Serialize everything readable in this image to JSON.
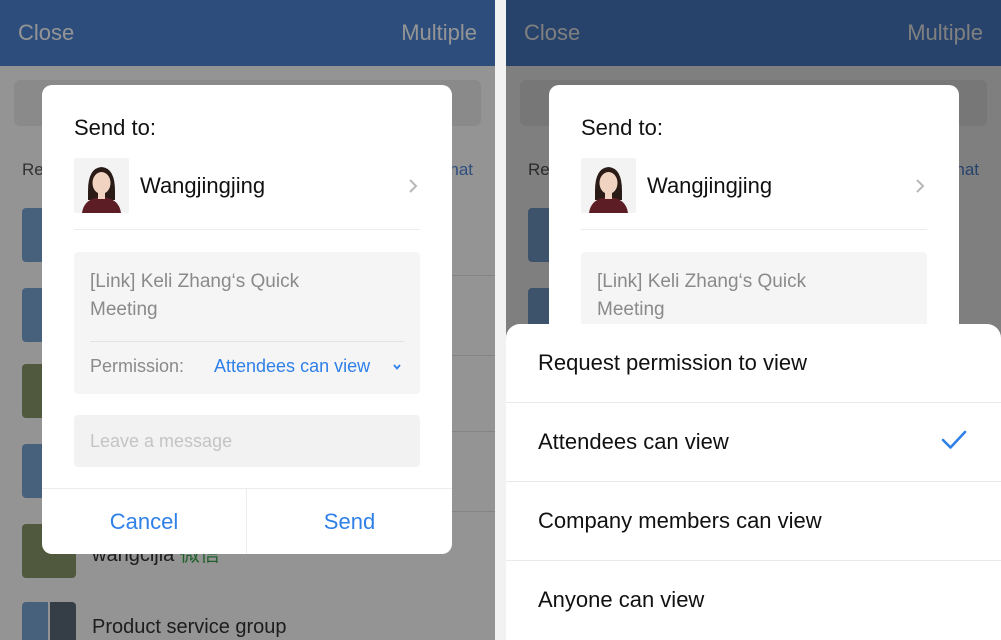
{
  "left": {
    "nav": {
      "close_label": "Close",
      "multiple_label": "Multiple"
    },
    "background": {
      "recent_label": "Re",
      "chat_label": "hat",
      "rows": [
        {
          "text": "wangcijia",
          "suffix": "微信"
        },
        {
          "text": "Product service group"
        }
      ]
    },
    "dialog": {
      "title": "Send to:",
      "recipient_name": "Wangjingjing",
      "link_text": "[Link] Keli Zhang‘s Quick Meeting",
      "permission_label": "Permission:",
      "permission_value": "Attendees can view",
      "message_placeholder": "Leave a message",
      "cancel_label": "Cancel",
      "send_label": "Send"
    }
  },
  "right": {
    "nav": {
      "close_label": "Close",
      "multiple_label": "Multiple"
    },
    "background": {
      "recent_label": "Re",
      "chat_label": "hat"
    },
    "dialog": {
      "title": "Send to:",
      "recipient_name": "Wangjingjing",
      "link_text": "[Link] Keli Zhang‘s Quick Meeting"
    },
    "sheet": {
      "options": [
        {
          "label": "Request permission to view",
          "selected": false
        },
        {
          "label": "Attendees can view",
          "selected": true
        },
        {
          "label": "Company members can view",
          "selected": false
        },
        {
          "label": "Anyone can view",
          "selected": false
        }
      ]
    }
  },
  "colors": {
    "nav_bar": "#4f87d7",
    "link_blue": "#2f80e8",
    "overlay": "rgba(0,0,0,0.42)"
  }
}
